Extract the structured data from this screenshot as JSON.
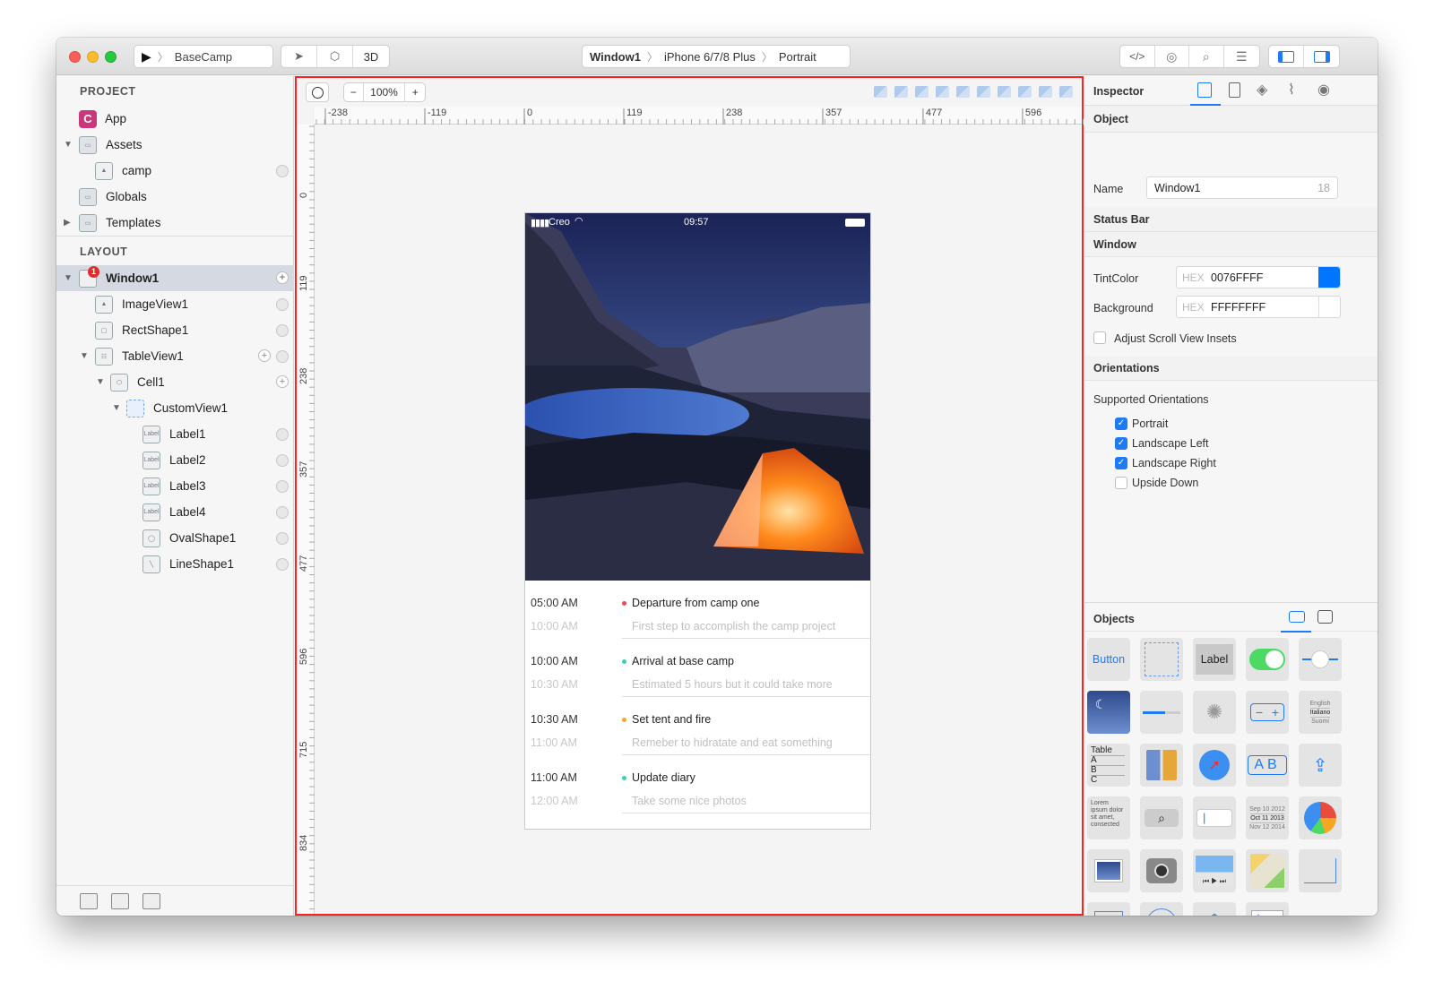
{
  "toolbar": {
    "scheme_name": "BaseCamp",
    "view_3d_label": "3D",
    "breadcrumb": [
      "Window1",
      "iPhone 6/7/8 Plus",
      "Portrait"
    ],
    "code_label": "</>"
  },
  "left_panel": {
    "project_title": "PROJECT",
    "layout_title": "LAYOUT",
    "project_items": [
      {
        "label": "App"
      },
      {
        "label": "Assets"
      },
      {
        "label": "camp"
      },
      {
        "label": "Globals"
      },
      {
        "label": "Templates"
      }
    ],
    "layout_items": [
      {
        "label": "Window1",
        "badge": "1"
      },
      {
        "label": "ImageView1"
      },
      {
        "label": "RectShape1"
      },
      {
        "label": "TableView1"
      },
      {
        "label": "Cell1"
      },
      {
        "label": "CustomView1"
      },
      {
        "label": "Label1",
        "icon_text": "Label"
      },
      {
        "label": "Label2",
        "icon_text": "Label"
      },
      {
        "label": "Label3",
        "icon_text": "Label"
      },
      {
        "label": "Label4",
        "icon_text": "Label"
      },
      {
        "label": "OvalShape1"
      },
      {
        "label": "LineShape1"
      }
    ]
  },
  "canvas": {
    "zoom": "100%",
    "zoom_minus": "−",
    "zoom_plus": "+",
    "h_ruler": [
      "-238",
      "-119",
      "0",
      "119",
      "238",
      "357",
      "477",
      "596"
    ],
    "v_ruler": [
      "0",
      "119",
      "238",
      "357",
      "477",
      "596",
      "715",
      "834"
    ],
    "device": {
      "status_carrier": "Creo",
      "status_time": "09:57",
      "rows": [
        {
          "time": "05:00 AM",
          "end": "10:00 AM",
          "title": "Departure from camp one",
          "subtitle": "First step to accomplish the camp project",
          "dot_color": "#e84c5a"
        },
        {
          "time": "10:00 AM",
          "end": "10:30 AM",
          "title": "Arrival at base camp",
          "subtitle": "Estimated 5 hours but it could take more",
          "dot_color": "#3ecfae"
        },
        {
          "time": "10:30 AM",
          "end": "11:00 AM",
          "title": "Set tent and fire",
          "subtitle": "Remeber to hidratate and eat something",
          "dot_color": "#f5a623"
        },
        {
          "time": "11:00 AM",
          "end": "12:00 AM",
          "title": "Update diary",
          "subtitle": "Take some nice photos",
          "dot_color": "#3ecfae"
        }
      ]
    }
  },
  "inspector": {
    "title": "Inspector",
    "object_section": "Object",
    "name_label": "Name",
    "name_value": "Window1",
    "name_count": "18",
    "status_bar_section": "Status Bar",
    "window_section": "Window",
    "tint_label": "TintColor",
    "tint_prefix": "HEX",
    "tint_value": "0076FFFF",
    "tint_color": "#0076FF",
    "background_label": "Background",
    "background_prefix": "HEX",
    "background_value": "FFFFFFFF",
    "adjust_label": "Adjust Scroll View Insets",
    "adjust_checked": false,
    "orientations_section": "Orientations",
    "supported_label": "Supported Orientations",
    "orientations": [
      {
        "label": "Portrait",
        "checked": true
      },
      {
        "label": "Landscape Left",
        "checked": true
      },
      {
        "label": "Landscape Right",
        "checked": true
      },
      {
        "label": "Upside Down",
        "checked": false
      }
    ]
  },
  "objects": {
    "title": "Objects",
    "button_label": "Button",
    "label_label": "Label",
    "table_label": "Table",
    "table_rows": [
      "A",
      "B",
      "C"
    ],
    "picker_items": [
      "English",
      "Italiano",
      "Suomi"
    ],
    "date_items": [
      "Sep 10 2012",
      "Oct 11 2013",
      "Nov 12 2014"
    ],
    "lorem": "Lorem ipsum dolor sit amet, consected",
    "ab_label": "AB"
  },
  "colors": {
    "accent": "#1e7bf4",
    "selection_border": "#ff2020",
    "switch_on": "#4cd964"
  }
}
